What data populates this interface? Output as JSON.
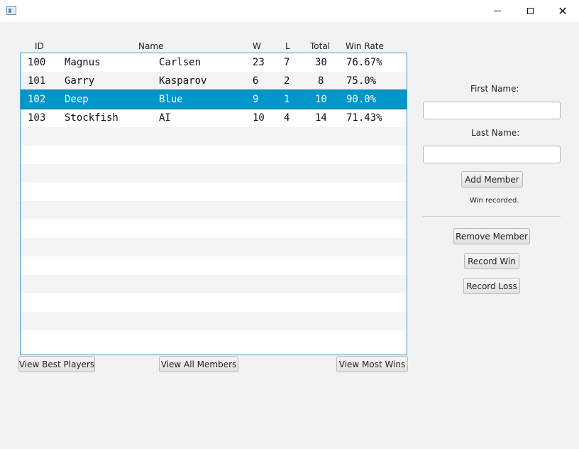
{
  "window": {
    "controls": {
      "minimize": "minimize-icon",
      "maximize": "maximize-icon",
      "close": "close-icon"
    }
  },
  "table": {
    "headers": {
      "id": "ID",
      "name": "Name",
      "w": "W",
      "l": "L",
      "total": "Total",
      "rate": "Win Rate"
    },
    "rows": [
      {
        "id": "100",
        "first": "Magnus",
        "last": "Carlsen",
        "w": "23",
        "l": "7",
        "total": "30",
        "rate": "76.67%"
      },
      {
        "id": "101",
        "first": "Garry",
        "last": "Kasparov",
        "w": "6",
        "l": "2",
        "total": "8",
        "rate": "75.0%"
      },
      {
        "id": "102",
        "first": "Deep",
        "last": "Blue",
        "w": "9",
        "l": "1",
        "total": "10",
        "rate": "90.0%"
      },
      {
        "id": "103",
        "first": "Stockfish",
        "last": "AI",
        "w": "10",
        "l": "4",
        "total": "14",
        "rate": "71.43%"
      }
    ],
    "selected_index": 2
  },
  "bottom_buttons": {
    "best": "View Best Players",
    "all": "View All Members",
    "most": "View Most Wins"
  },
  "side": {
    "first_name_label": "First Name:",
    "first_name_value": "",
    "last_name_label": "Last Name:",
    "last_name_value": "",
    "add_member": "Add Member",
    "status": "Win recorded.",
    "remove_member": "Remove Member",
    "record_win": "Record Win",
    "record_loss": "Record Loss"
  },
  "colors": {
    "selection": "#0096c9",
    "table_border": "#3c9ed1"
  }
}
